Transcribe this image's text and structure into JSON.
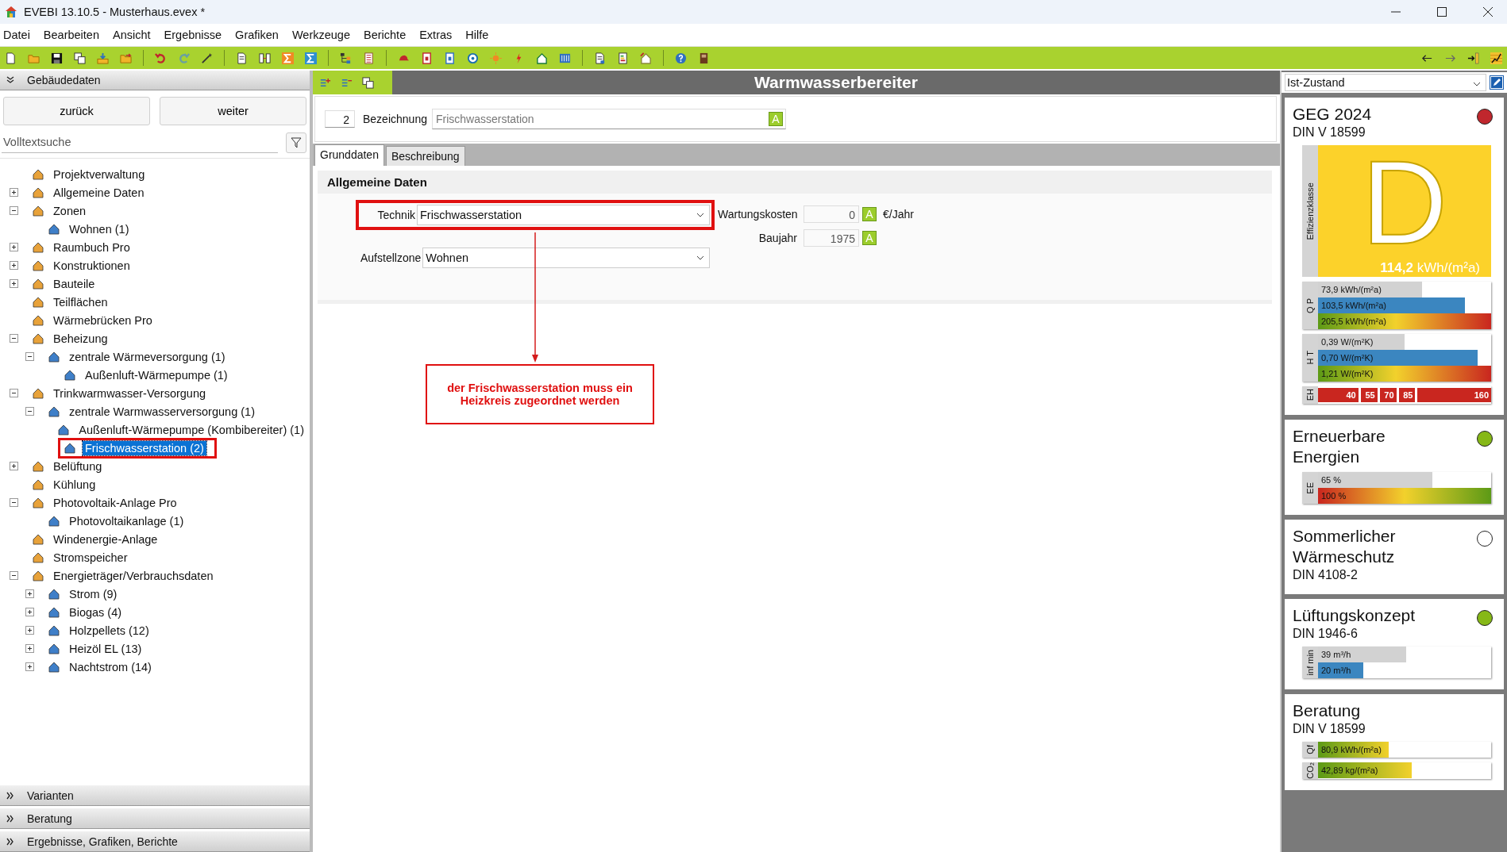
{
  "window": {
    "title": "EVEBI 13.10.5 - Musterhaus.evex *"
  },
  "menu": [
    "Datei",
    "Bearbeiten",
    "Ansicht",
    "Ergebnisse",
    "Grafiken",
    "Werkzeuge",
    "Berichte",
    "Extras",
    "Hilfe"
  ],
  "left_panel": {
    "header": "Gebäudedaten",
    "buttons": [
      "zurück",
      "weiter"
    ],
    "search": {
      "placeholder": "Volltextsuche"
    },
    "tree": [
      {
        "label": "Projektverwaltung",
        "selected": false
      },
      {
        "label": "Allgemeine Daten",
        "expanded": false,
        "selected": false
      },
      {
        "label": "Zonen",
        "expanded": true,
        "selected": false,
        "children": [
          {
            "label": "Wohnen (1)",
            "selected": false
          }
        ]
      },
      {
        "label": "Raumbuch Pro",
        "expanded": false,
        "selected": false
      },
      {
        "label": "Konstruktionen",
        "expanded": false,
        "selected": false
      },
      {
        "label": "Bauteile",
        "expanded": false,
        "selected": false
      },
      {
        "label": "Teilflächen",
        "selected": false
      },
      {
        "label": "Wärmebrücken Pro",
        "selected": false
      },
      {
        "label": "Beheizung",
        "expanded": true,
        "selected": false,
        "children": [
          {
            "label": "zentrale Wärmeversorgung (1)",
            "expanded": true,
            "selected": false,
            "children": [
              {
                "label": "Außenluft-Wärmepumpe (1)",
                "selected": false
              }
            ]
          }
        ]
      },
      {
        "label": "Trinkwarmwasser-Versorgung",
        "expanded": true,
        "selected": false,
        "children": [
          {
            "label": "zentrale Warmwasserversorgung (1)",
            "expanded": true,
            "selected": false,
            "children": [
              {
                "label": "Außenluft-Wärmepumpe (Kombibereiter) (1)",
                "selected": false
              },
              {
                "label": "Frischwasserstation (2)",
                "selected": true,
                "highlighted": true
              }
            ]
          }
        ]
      },
      {
        "label": "Belüftung",
        "expanded": false,
        "selected": false
      },
      {
        "label": "Kühlung",
        "selected": false
      },
      {
        "label": "Photovoltaik-Anlage Pro",
        "expanded": true,
        "selected": false,
        "children": [
          {
            "label": "Photovoltaikanlage (1)",
            "selected": false
          }
        ]
      },
      {
        "label": "Windenergie-Anlage",
        "selected": false
      },
      {
        "label": "Stromspeicher",
        "selected": false
      },
      {
        "label": "Energieträger/Verbrauchsdaten",
        "expanded": true,
        "selected": false,
        "children": [
          {
            "label": "Strom (9)",
            "expanded": false,
            "selected": false
          },
          {
            "label": "Biogas (4)",
            "expanded": false,
            "selected": false
          },
          {
            "label": "Holzpellets (12)",
            "expanded": false,
            "selected": false
          },
          {
            "label": "Heizöl EL (13)",
            "expanded": false,
            "selected": false
          },
          {
            "label": "Nachtstrom (14)",
            "expanded": false,
            "selected": false
          }
        ]
      }
    ],
    "sections": [
      "Varianten",
      "Beratung",
      "Ergebnisse, Grafiken, Berichte"
    ]
  },
  "editor": {
    "title": "Warmwasserbereiter",
    "number": "2",
    "name_label": "Bezeichnung",
    "name_value": "Frischwasserstation",
    "name_button": "A",
    "tabs": [
      {
        "label": "Grunddaten",
        "selected": true
      },
      {
        "label": "Beschreibung",
        "selected": false
      }
    ],
    "section_title": "Allgemeine Daten",
    "left_fields": [
      {
        "label": "Technik",
        "value": "Frischwasserstation",
        "highlighted": true
      },
      {
        "label": "Aufstellzone",
        "value": "Wohnen",
        "highlighted": false
      }
    ],
    "right_fields": [
      {
        "label": "Wartungskosten",
        "value": "0",
        "button": "A",
        "unit": "€/Jahr"
      },
      {
        "label": "Baujahr",
        "value": "1975",
        "button": "A"
      }
    ],
    "callout": "der Frischwasserstation muss ein Heizkreis zugeordnet werden"
  },
  "right_panel": {
    "scenario": "Ist-Zustand",
    "cards": [
      {
        "title": "GEG 2024",
        "subtitle": "DIN V 18599",
        "color": "#c0272d",
        "rating": {
          "caption": "Effizienzklasse",
          "letter": "D",
          "value": "**114,2** kWh/(m²a)"
        },
        "groups": [
          {
            "label": "Q P",
            "bars": [
              {
                "kind": "gray",
                "text": "73,9 kWh/(m²a)",
                "level": 0.6
              },
              {
                "kind": "blue",
                "text": "103,5 kWh/(m²a)",
                "level": 0.85
              },
              {
                "kind": "rising",
                "text": "205,5 kWh/(m²a)",
                "level": 1
              }
            ]
          },
          {
            "label": "H T",
            "bars": [
              {
                "kind": "gray",
                "text": "0,39 W/(m²K)",
                "level": 0.5
              },
              {
                "kind": "blue",
                "text": "0,70 W/(m²K)",
                "level": 0.92
              },
              {
                "kind": "rising",
                "text": "1,21 W/(m²K)",
                "level": 1
              }
            ]
          }
        ],
        "scale": {
          "label": "EH",
          "marks": [
            "40",
            "55",
            "70",
            "85",
            "160"
          ]
        }
      },
      {
        "title": "Erneuerbare Energien",
        "color": "#86b817",
        "groups": [
          {
            "label": "EE",
            "bars": [
              {
                "kind": "gray",
                "text": "65 %",
                "level": 0.66
              },
              {
                "kind": "falling",
                "text": "100 %",
                "level": 1
              }
            ]
          }
        ]
      },
      {
        "title": "Sommerlicher Wärmeschutz",
        "subtitle": "DIN 4108-2",
        "color": "#ffffff"
      },
      {
        "title": "Lüftungskonzept",
        "subtitle": "DIN 1946-6",
        "color": "#86b817",
        "groups": [
          {
            "label": "inf min",
            "bars": [
              {
                "kind": "gray",
                "text": "39 m³/h",
                "level": 0.51
              },
              {
                "kind": "blue",
                "text": "20 m³/h",
                "level": 0.26
              }
            ]
          }
        ]
      },
      {
        "title": "Beratung",
        "subtitle": "DIN V 18599",
        "groups": [
          {
            "label": "Qf",
            "bars": [
              {
                "kind": "green",
                "text": "80,9 kWh/(m²a)",
                "level": 0.41
              }
            ]
          },
          {
            "label": "CO₂",
            "bars": [
              {
                "kind": "green",
                "text": "42,89 kg/(m²a)",
                "level": 0.54
              }
            ]
          }
        ]
      }
    ]
  }
}
